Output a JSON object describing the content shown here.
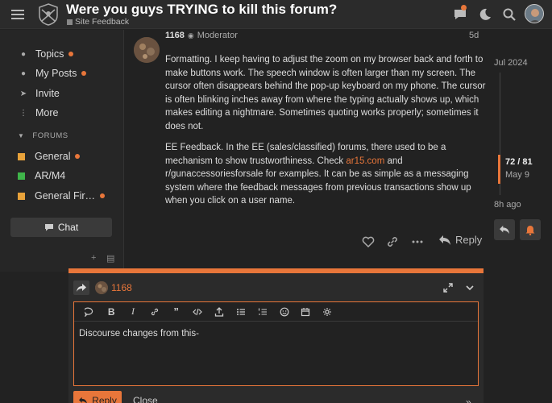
{
  "header": {
    "title": "Were you guys TRYING to kill this forum?",
    "category": "Site Feedback",
    "category_color": "#888888",
    "icons": [
      "hamburger-icon",
      "chat-icon",
      "moon-icon",
      "search-icon",
      "avatar"
    ]
  },
  "sidebar": {
    "items": [
      {
        "label": "Topics",
        "icon": "topics-icon",
        "dot": true
      },
      {
        "label": "My Posts",
        "icon": "user-icon",
        "dot": true
      },
      {
        "label": "Invite",
        "icon": "send-icon",
        "dot": false
      },
      {
        "label": "More",
        "icon": "more-icon",
        "dot": false
      }
    ],
    "section_label": "FORUMS",
    "categories": [
      {
        "label": "General",
        "color": "#e8a23a",
        "dot": true
      },
      {
        "label": "AR/M4",
        "color": "#3fb54a",
        "dot": false
      },
      {
        "label": "General Fir…",
        "color": "#e8a23a",
        "dot": true
      }
    ],
    "chat_label": "Chat"
  },
  "post": {
    "username": "1168",
    "role": "Moderator",
    "date": "5d",
    "paragraph1": "Formatting. I keep having to adjust the zoom on my browser back and forth to make buttons work. The speech window is often larger than my screen. The cursor often disappears behind the pop-up keyboard on my phone. The cursor is often blinking inches away from where the typing actually shows up, which makes editing a nightmare. Sometimes quoting works properly; sometimes it does not.",
    "paragraph2_before": "EE Feedback. In the EE (sales/classified) forums, there used to be a mechanism to show trustworthiness. Check ",
    "paragraph2_link": "ar15.com",
    "paragraph2_after": " and r/gunaccessoriesforsale for examples. It can be as simple as a messaging system where the feedback messages from previous transactions show up when you click on a user name.",
    "reply_label": "Reply"
  },
  "timeline": {
    "start": "Jul 2024",
    "position": "72 / 81",
    "position_date": "May 9",
    "end": "8h ago"
  },
  "composer": {
    "username": "1168",
    "draft_text": "Discourse changes from this-",
    "reply_button": "Reply",
    "close_button": "Close",
    "accent_color": "#e8763a"
  }
}
